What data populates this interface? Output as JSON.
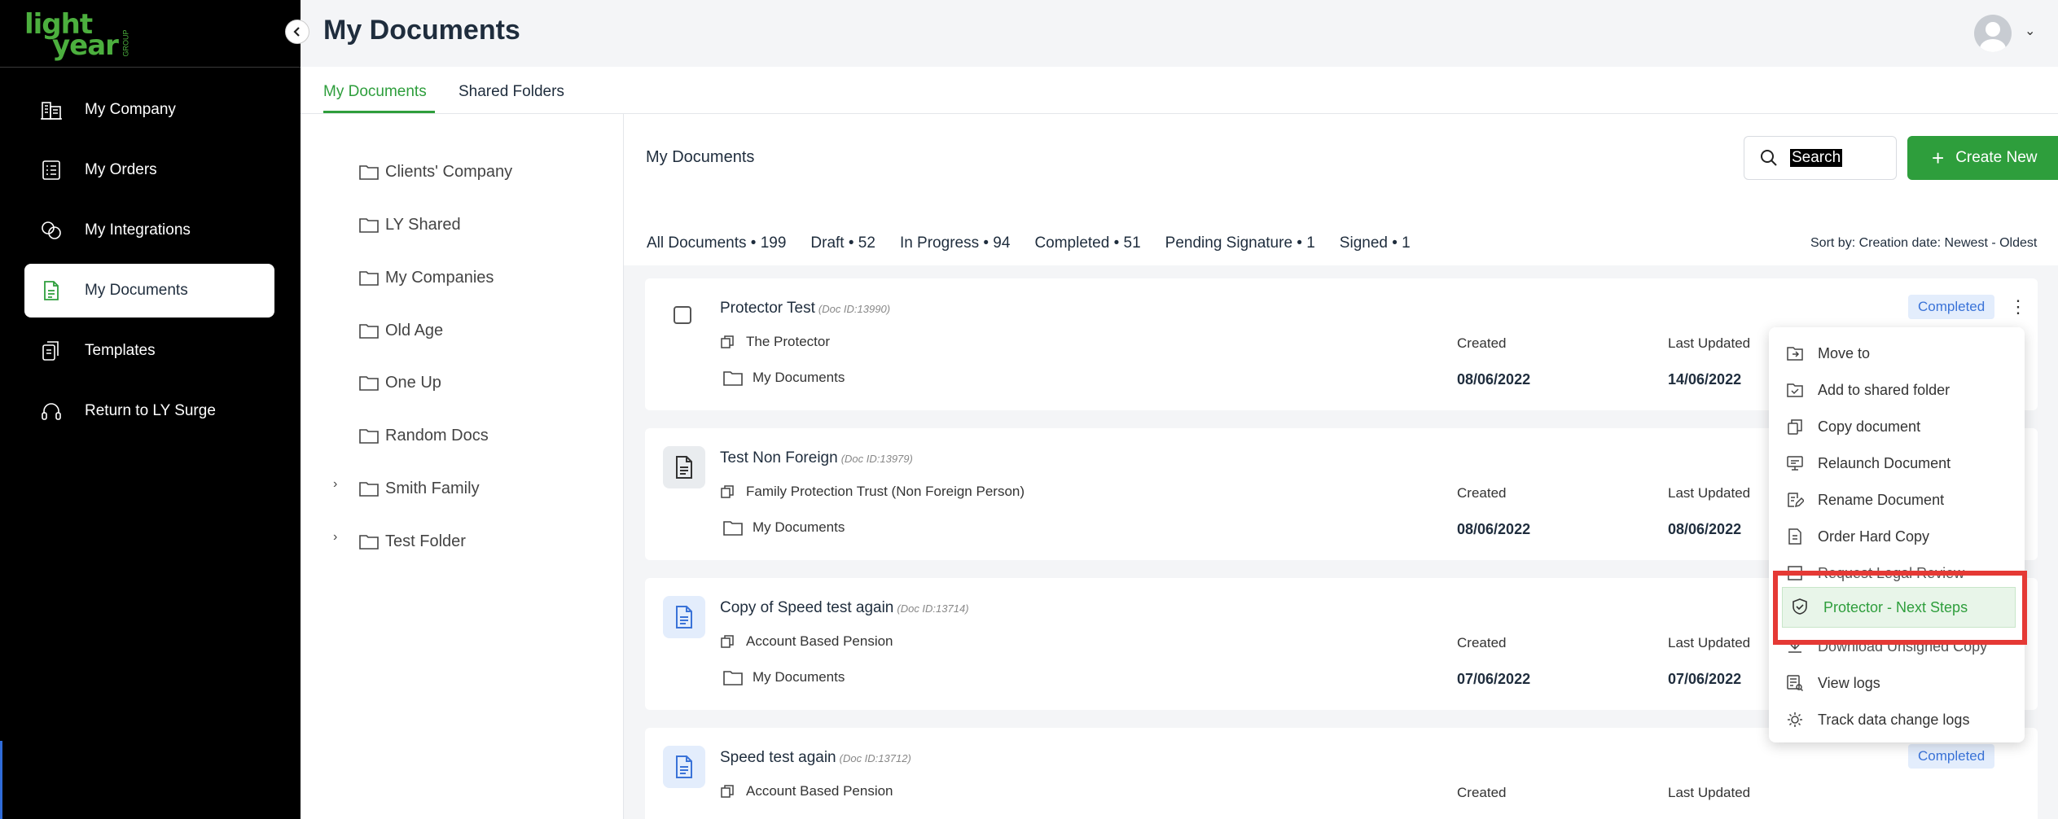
{
  "brand": {
    "logo_top": "light",
    "logo_bottom": "year",
    "logo_tag": "GROUP"
  },
  "header": {
    "title": "My Documents"
  },
  "sidebar": {
    "items": [
      {
        "label": "My Company",
        "icon": "building-icon"
      },
      {
        "label": "My Orders",
        "icon": "list-icon"
      },
      {
        "label": "My Integrations",
        "icon": "integrations-icon"
      },
      {
        "label": "My Documents",
        "icon": "document-icon",
        "active": true
      },
      {
        "label": "Templates",
        "icon": "templates-icon"
      },
      {
        "label": "Return to LY Surge",
        "icon": "headset-icon"
      }
    ]
  },
  "tabs": [
    {
      "label": "My Documents",
      "active": true
    },
    {
      "label": "Shared Folders",
      "active": false
    }
  ],
  "folders": [
    {
      "label": "Clients' Company",
      "expandable": false
    },
    {
      "label": "LY Shared",
      "expandable": false
    },
    {
      "label": "My Companies",
      "expandable": false
    },
    {
      "label": "Old Age",
      "expandable": false
    },
    {
      "label": "One Up",
      "expandable": false
    },
    {
      "label": "Random Docs",
      "expandable": false
    },
    {
      "label": "Smith Family",
      "expandable": true
    },
    {
      "label": "Test Folder",
      "expandable": true
    }
  ],
  "main": {
    "section_title": "My Documents",
    "search_placeholder": "Search",
    "create_label": "Create New",
    "filters": [
      "All Documents • 199",
      "Draft • 52",
      "In Progress • 94",
      "Completed • 51",
      "Pending Signature • 1",
      "Signed • 1"
    ],
    "sort_label": "Sort by: Creation date: Newest - Oldest"
  },
  "documents": [
    {
      "title": "Protector Test",
      "doc_id": "(Doc ID:13990)",
      "type": "The Protector",
      "folder": "My Documents",
      "created_label": "Created",
      "created": "08/06/2022",
      "updated_label": "Last Updated",
      "updated": "14/06/2022",
      "status": "Completed"
    },
    {
      "title": "Test Non Foreign",
      "doc_id": "(Doc ID:13979)",
      "type": "Family Protection Trust (Non Foreign Person)",
      "folder": "My Documents",
      "created_label": "Created",
      "created": "08/06/2022",
      "updated_label": "Last Updated",
      "updated": "08/06/2022"
    },
    {
      "title": "Copy of Speed test again",
      "doc_id": "(Doc ID:13714)",
      "type": "Account Based Pension",
      "folder": "My Documents",
      "created_label": "Created",
      "created": "07/06/2022",
      "updated_label": "Last Updated",
      "updated": "07/06/2022"
    },
    {
      "title": "Speed test again",
      "doc_id": "(Doc ID:13712)",
      "type": "Account Based Pension",
      "folder": "My Documents",
      "created_label": "Created",
      "created": "",
      "updated_label": "Last Updated",
      "updated": "",
      "status": "Completed"
    }
  ],
  "context_menu": {
    "items": [
      {
        "label": "Move to",
        "icon": "move-icon"
      },
      {
        "label": "Add to shared folder",
        "icon": "shared-folder-icon"
      },
      {
        "label": "Copy document",
        "icon": "copy-icon"
      },
      {
        "label": "Relaunch Document",
        "icon": "relaunch-icon"
      },
      {
        "label": "Rename Document",
        "icon": "rename-icon"
      },
      {
        "label": "Order Hard Copy",
        "icon": "order-icon"
      },
      {
        "label": "Request Legal Review",
        "icon": "review-icon"
      },
      {
        "label": "Protector - Next Steps",
        "icon": "shield-check-icon",
        "highlighted": true
      },
      {
        "label": "Download Unsigned Copy",
        "icon": "download-icon"
      },
      {
        "label": "View logs",
        "icon": "logs-icon"
      },
      {
        "label": "Track data change logs",
        "icon": "track-icon"
      }
    ]
  },
  "colors": {
    "accent": "#2e9e3c",
    "sidebar_bg": "#000000",
    "status_bg": "#e3edfc",
    "status_text": "#3a73d8",
    "highlight": "#e53935"
  }
}
